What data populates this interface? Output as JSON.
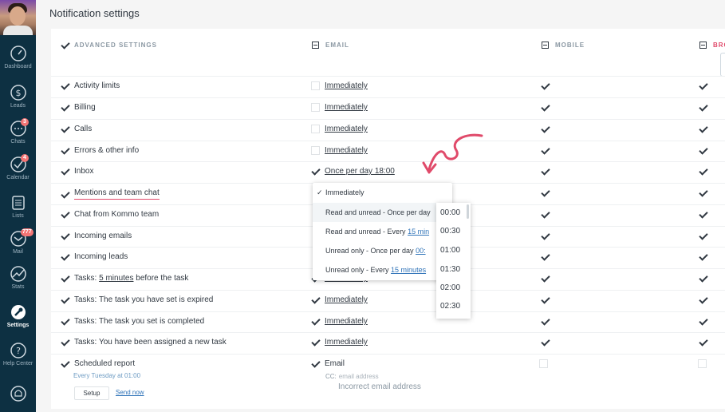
{
  "sidebar": {
    "items": [
      {
        "label": "Dashboard",
        "icon": "speedometer-icon",
        "badge": ""
      },
      {
        "label": "Leads",
        "icon": "dollar-icon",
        "badge": ""
      },
      {
        "label": "Chats",
        "icon": "chat-icon",
        "badge": "3"
      },
      {
        "label": "Calendar",
        "icon": "check-circle-icon",
        "badge": "4"
      },
      {
        "label": "Lists",
        "icon": "list-icon",
        "badge": ""
      },
      {
        "label": "Mail",
        "icon": "mail-icon",
        "badge": "777"
      },
      {
        "label": "Stats",
        "icon": "stats-icon",
        "badge": ""
      },
      {
        "label": "Settings",
        "icon": "wrench-icon",
        "badge": ""
      },
      {
        "label": "Help Center",
        "icon": "help-icon",
        "badge": ""
      },
      {
        "label": "",
        "icon": "bell-icon",
        "badge": ""
      }
    ]
  },
  "header": {
    "title": "Notification settings"
  },
  "columns": {
    "advanced": "ADVANCED SETTINGS",
    "email": "EMAIL",
    "mobile": "MOBILE",
    "browser": "BRO"
  },
  "rows": [
    {
      "label": "Activity limits",
      "email": "Immediately",
      "email_checked": false
    },
    {
      "label": "Billing",
      "email": "Immediately",
      "email_checked": false
    },
    {
      "label": "Calls",
      "email": "Immediately",
      "email_checked": false
    },
    {
      "label": "Errors & other info",
      "email": "Immediately",
      "email_checked": false
    },
    {
      "label": "Inbox",
      "email": "Once per day 18:00",
      "email_checked": true
    },
    {
      "label": "Mentions and team chat",
      "email": "",
      "email_checked": false
    },
    {
      "label": "Chat from Kommo team",
      "email": "",
      "email_checked": false
    },
    {
      "label": "Incoming emails",
      "email": "",
      "email_checked": false
    },
    {
      "label": "Incoming leads",
      "email": "",
      "email_checked": false
    },
    {
      "label_prefix": "Tasks: ",
      "label_link": "5 minutes",
      "label_suffix": " before the task",
      "email": "Immediately",
      "email_checked": true
    },
    {
      "label": "Tasks: The task you have set is expired",
      "email": "Immediately",
      "email_checked": true
    },
    {
      "label": "Tasks: The task you set is completed",
      "email": "Immediately",
      "email_checked": true
    },
    {
      "label": "Tasks: You have been assigned a new task",
      "email": "Immediately",
      "email_checked": true
    }
  ],
  "scheduled": {
    "label": "Scheduled report",
    "sub": "Every Tuesday at 01:00",
    "setup": "Setup",
    "send_now": "Send now",
    "email_label": "Email",
    "cc": "CC:",
    "cc_placeholder": "email address",
    "error": "Incorrect email address"
  },
  "dropdown": {
    "items": [
      {
        "text": "Immediately",
        "selected": true
      },
      {
        "text": "Read and unread - Once per day",
        "link": ""
      },
      {
        "text": "Read and unread - Every ",
        "link": "15 min"
      },
      {
        "text": "Unread only - Once per day ",
        "link": "00:"
      },
      {
        "text": "Unread only - Every ",
        "link": "15 minutes"
      }
    ]
  },
  "times": [
    "00:00",
    "00:30",
    "01:00",
    "01:30",
    "02:00",
    "02:30"
  ],
  "colors": {
    "sidebar": "#0d3042",
    "accent_link": "#2f73b8",
    "badge": "#f37575",
    "arrow": "#e04a6a"
  }
}
